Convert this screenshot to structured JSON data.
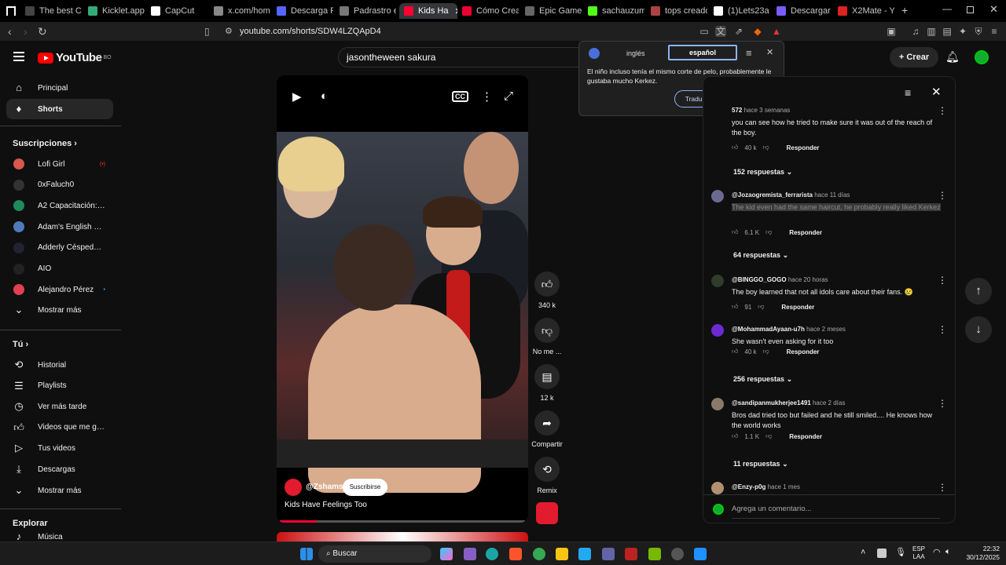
{
  "browser": {
    "tabs": [
      {
        "label": "The best Ch",
        "color": "#444"
      },
      {
        "label": "Kicklet.app -",
        "color": "#3a7"
      },
      {
        "label": "CapCut",
        "color": "#fff"
      },
      {
        "label": "x.com/home",
        "color": "#888"
      },
      {
        "label": "Descarga Ro",
        "color": "#5566ff"
      },
      {
        "label": "Padrastro ex",
        "color": "#777"
      },
      {
        "label": "Kids Ha",
        "color": "#ff0033"
      },
      {
        "label": "Cómo Crear",
        "color": "#e03"
      },
      {
        "label": "Epic Games",
        "color": "#666"
      },
      {
        "label": "sachauzuma",
        "color": "#53fc18"
      },
      {
        "label": "tops creado",
        "color": "#a44"
      },
      {
        "label": "(1)Lets23a ((",
        "color": "#fff"
      },
      {
        "label": "Descargar vi",
        "color": "#7a5cff"
      },
      {
        "label": "X2Mate - Yo",
        "color": "#d22"
      }
    ],
    "url": "youtube.com/shorts/SDW4LZQApD4"
  },
  "header": {
    "logo": "YouTube",
    "country": "BO",
    "search_value": "jasontheween sakura",
    "create_label": "Crear"
  },
  "sidebar": {
    "top": [
      {
        "label": "Principal",
        "icon": "home-icon"
      },
      {
        "label": "Shorts",
        "icon": "shorts-icon"
      }
    ],
    "subs_title": "Suscripciones",
    "subs": [
      {
        "label": "Lofi Girl",
        "live": "(•)"
      },
      {
        "label": "0xFaluch0",
        "live": ""
      },
      {
        "label": "A2 Capacitación: E...",
        "live": ""
      },
      {
        "label": "Adam's English Les...",
        "live": ""
      },
      {
        "label": "Adderly Céspedes (...",
        "live": ""
      },
      {
        "label": "AIO",
        "live": ""
      },
      {
        "label": "Alejandro Pérez",
        "live": "•"
      }
    ],
    "show_more": "Mostrar más",
    "you_title": "Tú",
    "you": [
      {
        "label": "Historial"
      },
      {
        "label": "Playlists"
      },
      {
        "label": "Ver más tarde"
      },
      {
        "label": "Videos que me gus..."
      },
      {
        "label": "Tus videos"
      },
      {
        "label": "Descargas"
      }
    ],
    "show_more_2": "Mostrar más",
    "explore_title": "Explorar",
    "explore_partial": "Música"
  },
  "short": {
    "channel": "@Zshams",
    "subscribe": "Suscribirse",
    "title": "Kids Have Feelings Too",
    "progress": 0.15
  },
  "actions": {
    "likes": "340 k",
    "dislike": "No me ...",
    "comments": "12 k",
    "share": "Compartir",
    "remix": "Remix"
  },
  "translate": {
    "from": "inglés",
    "to": "español",
    "text": "El niño incluso tenía el mismo corte de pelo, probablemente le gustaba mucho Kerkez.",
    "button": "Traducir la página completa"
  },
  "comments": {
    "first_partial": {
      "author": "572",
      "time": "hace 3 semanas",
      "text": "you can see how he tried to make sure it was out of the reach of the boy.",
      "likes": "40 k",
      "reply": "Responder",
      "replies": "152 respuestas"
    },
    "list": [
      {
        "author": "@Jozaogremista_ferrarista",
        "time": "hace 11 días",
        "text": "The kid even had the same haircut, he probably really liked Kerkez",
        "likes": "6.1 K",
        "reply": "Responder",
        "replies": "64 respuestas",
        "avatar": "#6a6a90"
      },
      {
        "author": "@BINGGO_GOGO",
        "time": "hace 20 horas",
        "text": "The boy learned that not all idols care about their fans. 😢",
        "likes": "91",
        "reply": "Responder",
        "replies": "",
        "avatar": "#2f3d2a"
      },
      {
        "author": "@MohammadAyaan-u7h",
        "time": "hace 2 meses",
        "text": "She wasn't even asking for it too",
        "likes": "40 k",
        "reply": "Responder",
        "replies": "256 respuestas",
        "avatar": "#6b2bd1"
      },
      {
        "author": "@sandipanmukherjee1491",
        "time": "hace 2 días",
        "text": "Bros dad tried too but failed and he still smiled.... He knows how the world works",
        "likes": "1.1 K",
        "reply": "Responder",
        "replies": "11 respuestas",
        "avatar": "#8a7a6a"
      },
      {
        "author": "@Enzy-p0g",
        "time": "hace 1 mes",
        "text": "",
        "likes": "",
        "reply": "",
        "replies": "",
        "avatar": "#b09070"
      }
    ],
    "add_placeholder": "Agrega un comentario..."
  },
  "taskbar": {
    "search": "Buscar",
    "lang": "ESP",
    "lang2": "LAA",
    "time": "22:32",
    "date": "30/12/2025"
  }
}
